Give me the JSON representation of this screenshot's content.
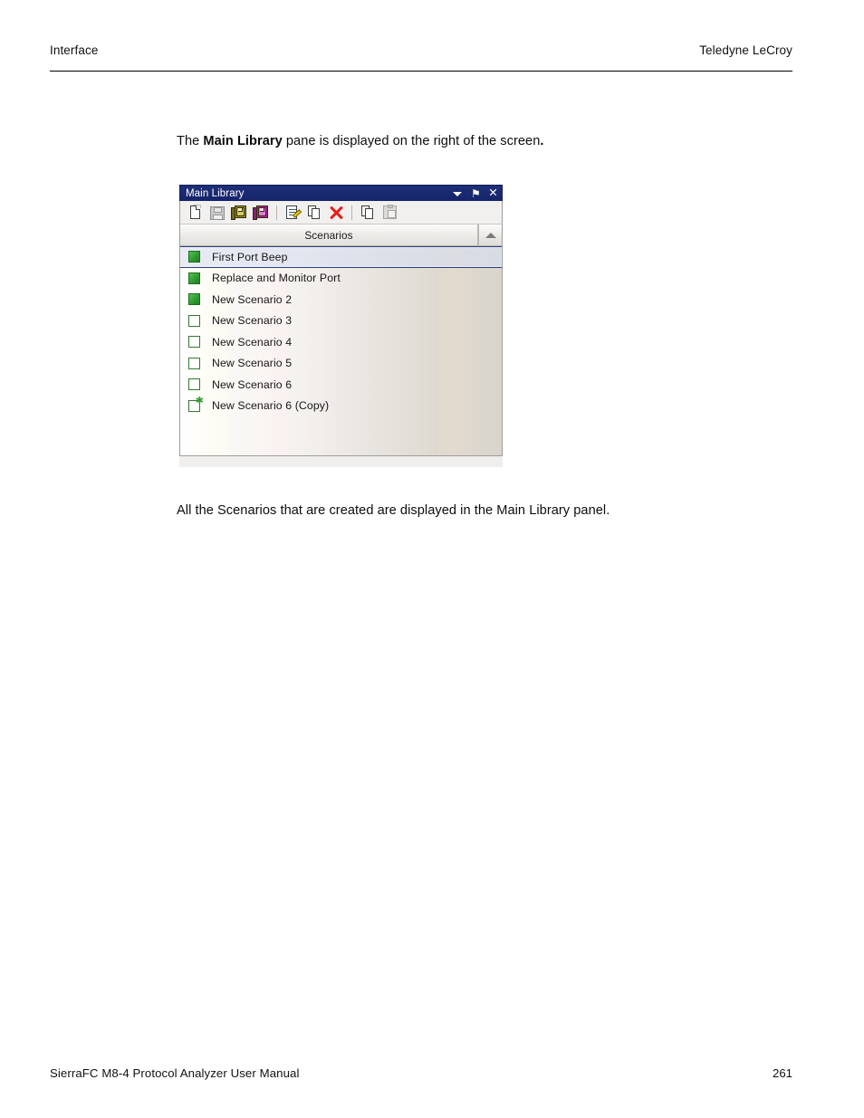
{
  "header": {
    "left": "Interface",
    "right": "Teledyne LeCroy"
  },
  "body": {
    "intro_prefix": "The ",
    "intro_bold": "Main Library",
    "intro_suffix": " pane is displayed on the right of the screen",
    "intro_period": ".",
    "caption": "All the Scenarios that are created are displayed in the Main Library panel."
  },
  "figure": {
    "titlebar": {
      "title": "Main Library",
      "controls": [
        {
          "name": "dropdown-caret-icon",
          "glyph": ""
        },
        {
          "name": "pin-icon",
          "glyph": "⚑"
        },
        {
          "name": "close-icon",
          "glyph": "✕"
        }
      ]
    },
    "toolbar": {
      "items": [
        {
          "name": "new-scenario-icon",
          "tooltip": "New",
          "enabled": true
        },
        {
          "name": "save-icon",
          "tooltip": "Save",
          "enabled": false
        },
        {
          "name": "open-library-icon",
          "tooltip": "Open Library",
          "enabled": true
        },
        {
          "name": "save-library-icon",
          "tooltip": "Save Library",
          "enabled": true
        },
        {
          "name": "edit-scenario-icon",
          "tooltip": "Edit",
          "enabled": true
        },
        {
          "name": "copy-scenario-icon",
          "tooltip": "Copy",
          "enabled": true
        },
        {
          "name": "delete-scenario-icon",
          "tooltip": "Delete",
          "enabled": true
        },
        {
          "name": "duplicate-icon",
          "tooltip": "Duplicate",
          "enabled": true
        },
        {
          "name": "paste-icon",
          "tooltip": "Paste",
          "enabled": false
        }
      ]
    },
    "column_header": {
      "label": "Scenarios",
      "sort_direction": "ascending"
    },
    "rows": [
      {
        "label": "First Port Beep",
        "checked": true,
        "selected": true,
        "modified": false
      },
      {
        "label": "Replace and Monitor Port",
        "checked": true,
        "selected": false,
        "modified": false
      },
      {
        "label": "New Scenario 2",
        "checked": true,
        "selected": false,
        "modified": false
      },
      {
        "label": "New Scenario 3",
        "checked": false,
        "selected": false,
        "modified": false
      },
      {
        "label": "New Scenario 4",
        "checked": false,
        "selected": false,
        "modified": false
      },
      {
        "label": "New Scenario 5",
        "checked": false,
        "selected": false,
        "modified": false
      },
      {
        "label": "New Scenario 6",
        "checked": false,
        "selected": false,
        "modified": false
      },
      {
        "label": "New Scenario 6 (Copy)",
        "checked": false,
        "selected": false,
        "modified": true,
        "modified_glyph": "✱"
      }
    ],
    "colors": {
      "titlebar": "#16256a",
      "checkbox_green": "#2f9c2f",
      "delete_red": "#e81c1c",
      "library_olive": "#a39a27",
      "library_magenta": "#c227b0",
      "selection_border": "#2b3f7c"
    }
  },
  "footer": {
    "left": "SierraFC M8-4 Protocol Analyzer User Manual",
    "right": "261"
  }
}
